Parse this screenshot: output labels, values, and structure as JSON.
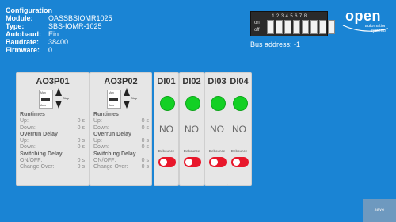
{
  "config": {
    "title": "Configuration",
    "rows": [
      {
        "k": "Module:",
        "v": "OASSBSIOMR1025"
      },
      {
        "k": "Type:",
        "v": "SBS-IOMR-1025"
      },
      {
        "k": "Autobaud:",
        "v": "Ein"
      },
      {
        "k": "Baudrate:",
        "v": "38400"
      },
      {
        "k": "Firmware:",
        "v": "0"
      }
    ]
  },
  "dip": {
    "numbers": "12345678",
    "on_label": "on",
    "off_label": "off",
    "bus_address": "Bus address: -1"
  },
  "logo": {
    "main": "open",
    "line1": "automation",
    "line2": "systems"
  },
  "ao_cards": [
    {
      "title": "AO3P01",
      "man": "Man",
      "off": "Off",
      "auto": "Auto",
      "stop": "Stop",
      "runtimes": "Runtimes",
      "up_label": "Up:",
      "up": "0 s",
      "down_label": "Down:",
      "down": "0 s",
      "overrun": "Overrun Delay",
      "o_up_label": "Up:",
      "o_up": "0 s",
      "o_down_label": "Down:",
      "o_down": "0 s",
      "switching": "Switching Delay",
      "onoff_label": "ON/OFF:",
      "onoff": "0 s",
      "change_label": "Change Over:",
      "change": "0 s"
    },
    {
      "title": "AO3P02",
      "man": "Man",
      "off": "Off",
      "auto": "Auto",
      "stop": "Stop",
      "runtimes": "Runtimes",
      "up_label": "Up:",
      "up": "0 s",
      "down_label": "Down:",
      "down": "0 s",
      "overrun": "Overrun Delay",
      "o_up_label": "Up:",
      "o_up": "0 s",
      "o_down_label": "Down:",
      "o_down": "0 s",
      "switching": "Switching Delay",
      "onoff_label": "ON/OFF:",
      "onoff": "0 s",
      "change_label": "Change Over:",
      "change": "0 s"
    }
  ],
  "di_cards": [
    {
      "title": "DI01",
      "state": "NO",
      "debounce": "Debounce"
    },
    {
      "title": "DI02",
      "state": "NO",
      "debounce": "Debounce"
    },
    {
      "title": "DI03",
      "state": "NO",
      "debounce": "Debounce"
    },
    {
      "title": "DI04",
      "state": "NO",
      "debounce": "Debounce"
    }
  ],
  "colors": {
    "background": "#1a84d4",
    "led_on": "#13d024",
    "toggle": "#e8172b",
    "save": "#6e99bf"
  },
  "save_label": "save"
}
